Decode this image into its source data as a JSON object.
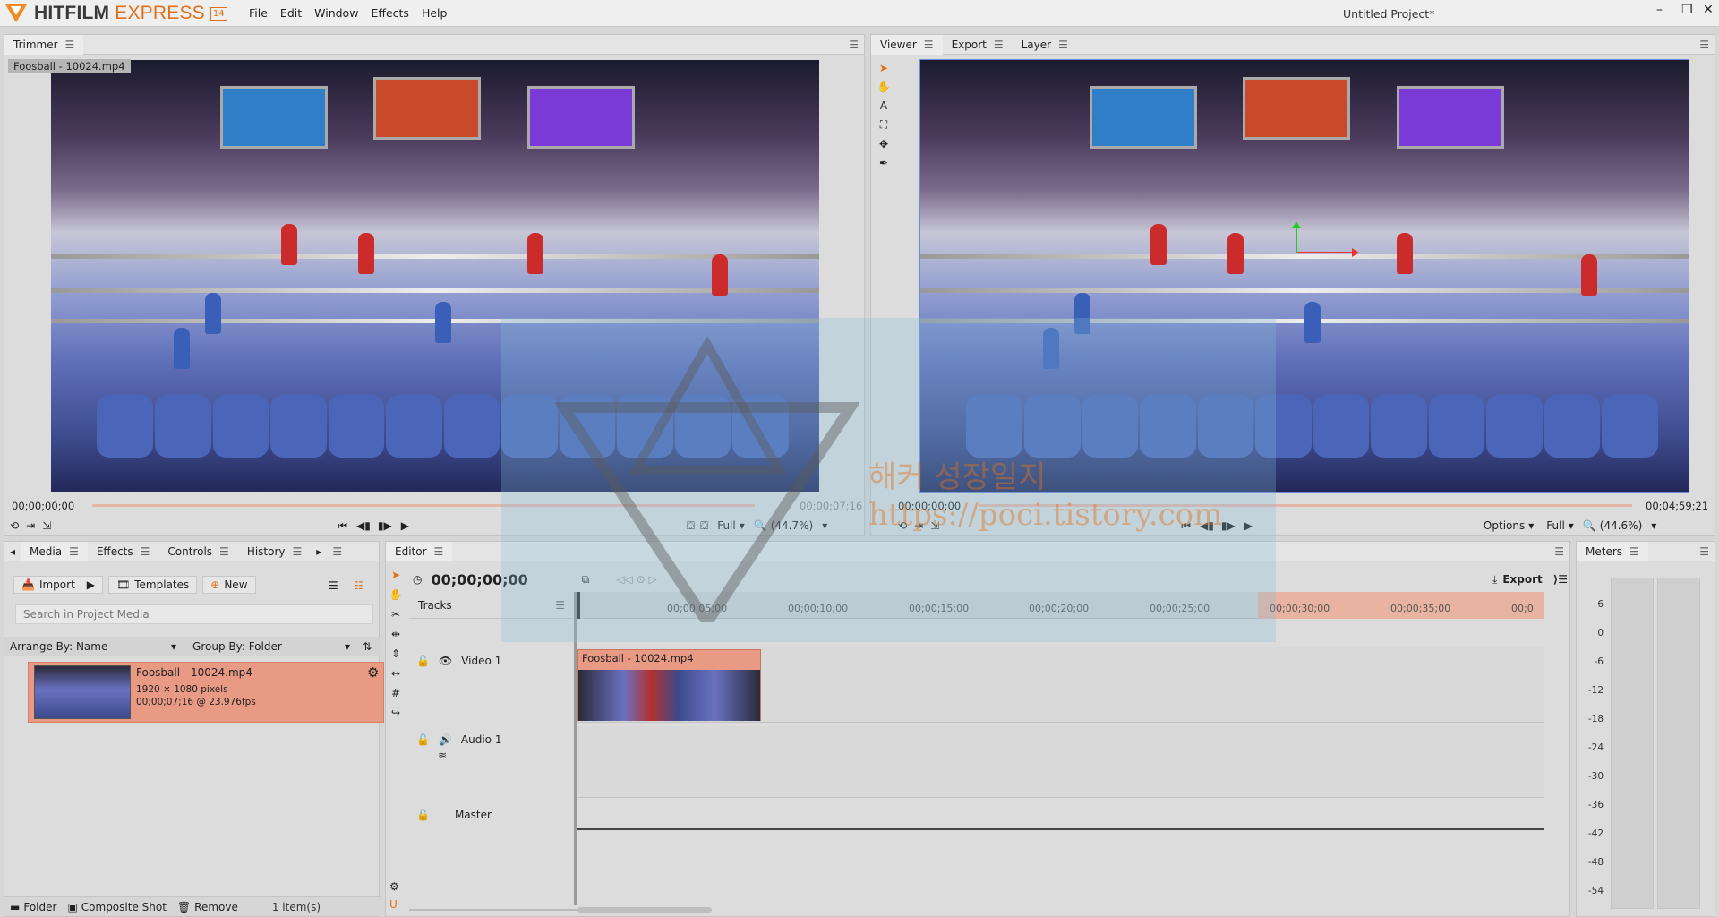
{
  "app": {
    "brand_main": "HITFILM",
    "brand_sub": "EXPRESS",
    "version": "14",
    "menu": [
      "File",
      "Edit",
      "Window",
      "Effects",
      "Help"
    ],
    "project_title": "Untitled Project*",
    "window_controls": {
      "minimize": "–",
      "restore": "❐",
      "close": "✕"
    }
  },
  "trimmer": {
    "tab": "Trimmer",
    "clip_label": "Foosball - 10024.mp4",
    "timecode_start": "00;00;00;00",
    "timecode_end": "00;00;07;16",
    "quality": "Full",
    "zoom": "(44.7%)"
  },
  "viewer": {
    "tabs": [
      "Viewer",
      "Export",
      "Layer"
    ],
    "timecode_start": "00;00;00;00",
    "timecode_end": "00;04;59;21",
    "options": "Options",
    "quality": "Full",
    "zoom": "(44.6%)"
  },
  "media": {
    "tabs": [
      "Media",
      "Effects",
      "Controls",
      "History"
    ],
    "import": "Import",
    "templates": "Templates",
    "new": "New",
    "search_placeholder": "Search in Project Media",
    "arrange_by": "Arrange By: Name",
    "group_by": "Group By: Folder",
    "item": {
      "name": "Foosball - 10024.mp4",
      "dims": "1920 × 1080 pixels",
      "info": "00;00;07;16 @ 23.976fps"
    },
    "footer": {
      "folder": "Folder",
      "composite": "Composite Shot",
      "remove": "Remove",
      "count": "1 item(s)"
    }
  },
  "editor": {
    "tab": "Editor",
    "timecode": "00;00;00;00",
    "export": "Export",
    "tracks_label": "Tracks",
    "ruler": [
      "00;00;05;00",
      "00;00;10;00",
      "00;00;15;00",
      "00;00;20;00",
      "00;00;25;00",
      "00;00;30;00",
      "00;00;35;00",
      "00;0"
    ],
    "video_track": "Video 1",
    "audio_track": "Audio 1",
    "master_track": "Master",
    "clip_name": "Foosball - 10024.mp4"
  },
  "meters": {
    "tab": "Meters",
    "scale": [
      "6",
      "0",
      "-6",
      "-12",
      "-18",
      "-24",
      "-30",
      "-36",
      "-42",
      "-48",
      "-54"
    ]
  },
  "watermark": {
    "text1": "해커 성장일지",
    "text2": "https://poci.tistory.com"
  },
  "icons": {
    "logo": "hitfilm-logo-icon",
    "hamburger": "hamburger-icon",
    "play": "play-icon"
  }
}
